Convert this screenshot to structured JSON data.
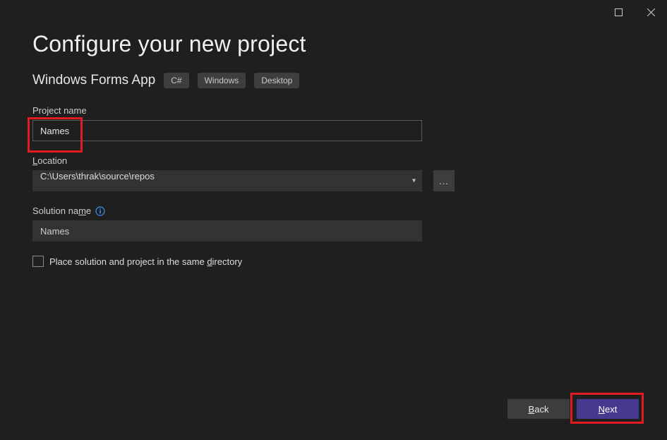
{
  "titlebar": {
    "maximize_icon": "maximize",
    "close_icon": "close"
  },
  "header": {
    "title": "Configure your new project",
    "subtitle": "Windows Forms App",
    "tags": [
      "C#",
      "Windows",
      "Desktop"
    ]
  },
  "fields": {
    "project_name_label_pre": "P",
    "project_name_label_post": "roject name",
    "project_name_value": "Names",
    "location_label_u": "L",
    "location_label_post": "ocation",
    "location_value": "C:\\Users\\thrak\\source\\repos",
    "browse_label": "...",
    "solution_label_pre": "Solution na",
    "solution_label_u": "m",
    "solution_label_post": "e",
    "solution_value": "Names",
    "checkbox_label_pre": "Place solution and project in the same ",
    "checkbox_label_u": "d",
    "checkbox_label_post": "irectory"
  },
  "footer": {
    "back_u": "B",
    "back_post": "ack",
    "next_u": "N",
    "next_post": "ext"
  },
  "colors": {
    "accent": "#47398f",
    "highlight": "#e11b22",
    "bg": "#1f1f1f"
  }
}
